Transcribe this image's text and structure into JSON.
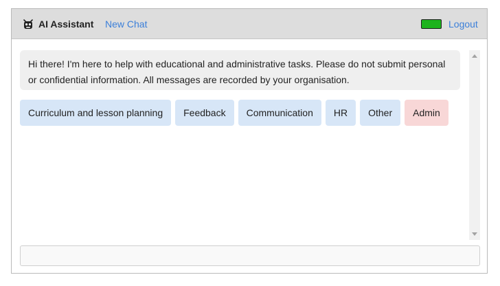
{
  "header": {
    "title": "AI Assistant",
    "logo_icon": "robot-icon",
    "new_chat_label": "New Chat",
    "logout_label": "Logout",
    "status_color": "#1db31d",
    "link_color": "#3b7fd9"
  },
  "chat": {
    "welcome_message": "Hi there! I'm here to help with educational and administrative tasks. Please do not submit personal or confidential information. All messages are recorded by your organisation."
  },
  "categories": [
    {
      "label": "Curriculum and lesson planning",
      "color": "#d7e6f7"
    },
    {
      "label": "Feedback",
      "color": "#d7e6f7"
    },
    {
      "label": "Communication",
      "color": "#d7e6f7"
    },
    {
      "label": "HR",
      "color": "#d7e6f7"
    },
    {
      "label": "Other",
      "color": "#d7e6f7"
    },
    {
      "label": "Admin",
      "color": "#f8d7d7"
    }
  ],
  "input": {
    "value": "",
    "placeholder": ""
  }
}
